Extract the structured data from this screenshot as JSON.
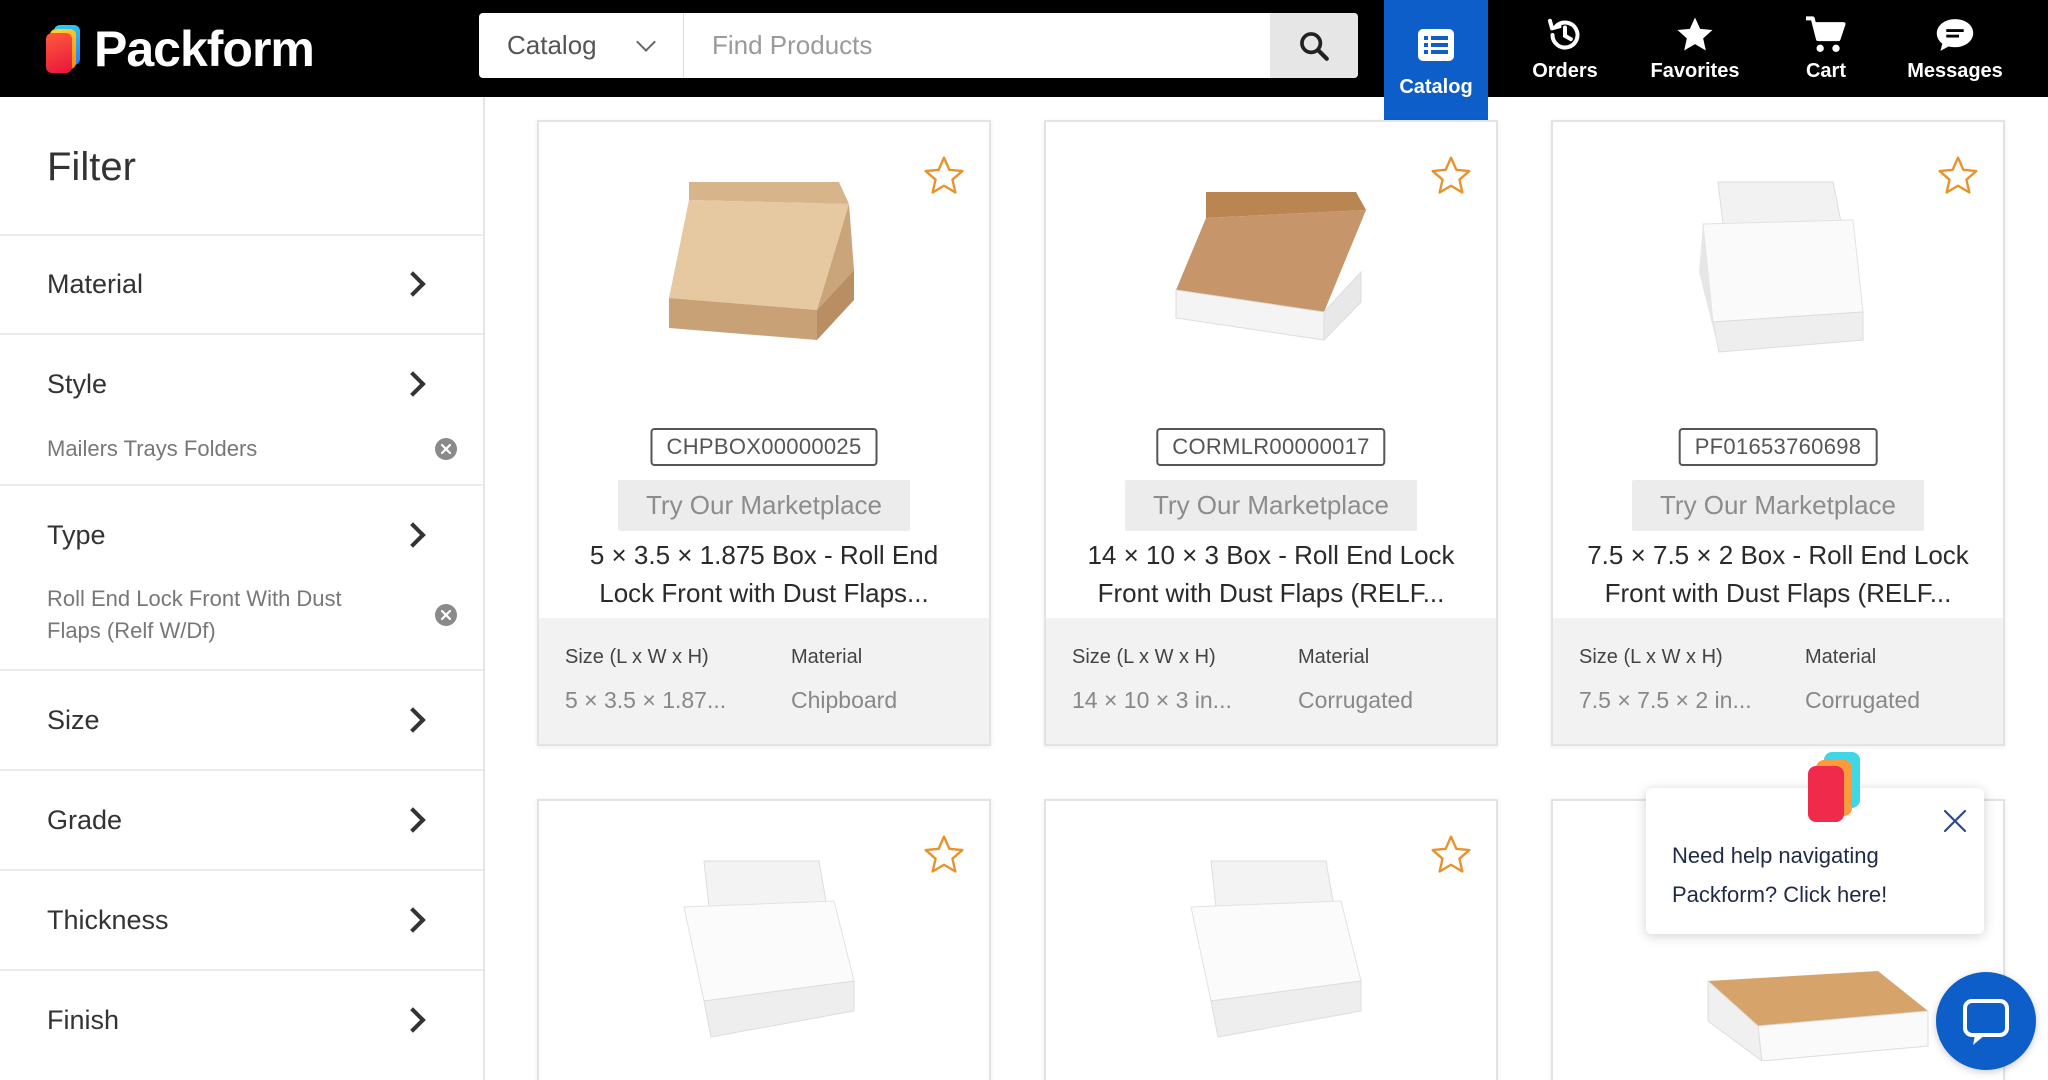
{
  "brand": {
    "name": "Packform"
  },
  "search": {
    "category": "Catalog",
    "placeholder": "Find Products"
  },
  "nav": {
    "catalog": "Catalog",
    "orders": "Orders",
    "favorites": "Favorites",
    "cart": "Cart",
    "messages": "Messages"
  },
  "filter": {
    "title": "Filter",
    "sections": {
      "material": {
        "label": "Material"
      },
      "style": {
        "label": "Style",
        "applied": "Mailers Trays Folders"
      },
      "type": {
        "label": "Type",
        "applied": "Roll End Lock Front With Dust Flaps (Relf W/Df)"
      },
      "size": {
        "label": "Size"
      },
      "grade": {
        "label": "Grade"
      },
      "thickness": {
        "label": "Thickness"
      },
      "finish": {
        "label": "Finish"
      }
    }
  },
  "spec_labels": {
    "size": "Size (L x W x H)",
    "material": "Material"
  },
  "products": [
    {
      "sku": "CHPBOX00000025",
      "marketplace": "Try Our Marketplace",
      "title": "5 × 3.5 × 1.875 Box - Roll End Lock Front with Dust Flaps...",
      "size": "5 × 3.5 × 1.87...",
      "material": "Chipboard",
      "box_color": "kraft",
      "favorited": false
    },
    {
      "sku": "CORMLR00000017",
      "marketplace": "Try Our Marketplace",
      "title": "14 × 10 × 3 Box - Roll End Lock Front with Dust Flaps (RELF...",
      "size": "14 × 10 × 3 in...",
      "material": "Corrugated",
      "box_color": "white-kraft",
      "favorited": false
    },
    {
      "sku": "PF01653760698",
      "marketplace": "Try Our Marketplace",
      "title": "7.5 × 7.5 × 2 Box - Roll End Lock Front with Dust Flaps (RELF...",
      "size": "7.5 × 7.5 × 2 in...",
      "material": "Corrugated",
      "box_color": "white",
      "favorited": false
    },
    {
      "box_color": "white",
      "favorited": false
    },
    {
      "box_color": "white",
      "favorited": false
    },
    {
      "box_color": "white-kraft-closed",
      "favorited": false
    }
  ],
  "help": {
    "text": "Need help navigating Packform? Click here!"
  },
  "colors": {
    "header_bg": "#000000",
    "catalog_active": "#0e5ec9",
    "star_outline": "#e8922b",
    "chat_button": "#0e5ec9"
  },
  "icons": [
    "search-icon",
    "catalog-list-icon",
    "history-icon",
    "star-icon",
    "cart-icon",
    "chat-bubble-icon",
    "chevron-right-icon",
    "remove-circle-icon",
    "close-icon",
    "chevron-down-icon"
  ]
}
